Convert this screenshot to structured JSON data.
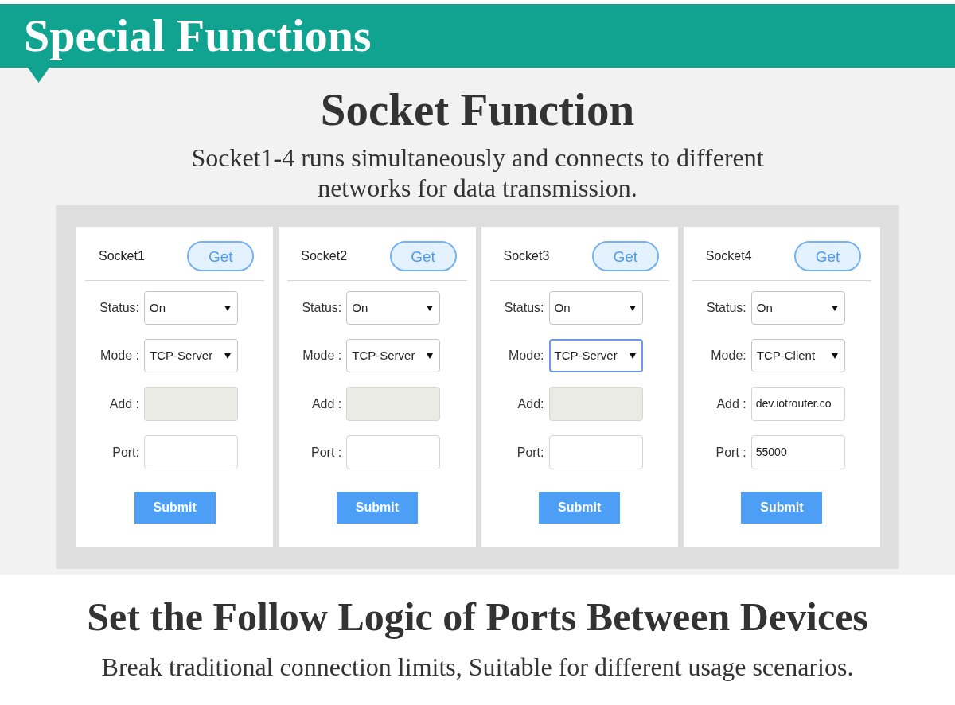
{
  "banner": {
    "title": "Special Functions"
  },
  "section": {
    "heading": "Socket Function",
    "description": "Socket1-4 runs simultaneously and connects to different networks for data transmission."
  },
  "sockets": [
    {
      "name": "Socket1",
      "get_button": "Get",
      "fields": [
        {
          "kind": "select",
          "label": "Status:",
          "value": "On",
          "focused": false
        },
        {
          "kind": "select",
          "label": "Mode :",
          "value": "TCP-Server",
          "focused": false
        },
        {
          "kind": "input",
          "label": "Add :",
          "disabled": true
        },
        {
          "kind": "input",
          "label": "Port:",
          "disabled": false
        }
      ],
      "submit_button": "Submit"
    },
    {
      "name": "Socket2",
      "get_button": "Get",
      "fields": [
        {
          "kind": "select",
          "label": "Status:",
          "value": "On",
          "focused": false
        },
        {
          "kind": "select",
          "label": "Mode :",
          "value": "TCP-Server",
          "focused": false
        },
        {
          "kind": "input",
          "label": "Add :",
          "disabled": true
        },
        {
          "kind": "input",
          "label": "Port :",
          "disabled": false
        }
      ],
      "submit_button": "Submit"
    },
    {
      "name": "Socket3",
      "get_button": "Get",
      "fields": [
        {
          "kind": "select",
          "label": "Status:",
          "value": "On",
          "focused": false
        },
        {
          "kind": "select",
          "label": "Mode:",
          "value": "TCP-Server",
          "focused": true
        },
        {
          "kind": "input",
          "label": "Add:",
          "disabled": true
        },
        {
          "kind": "input",
          "label": "Port:",
          "disabled": false
        }
      ],
      "submit_button": "Submit"
    },
    {
      "name": "Socket4",
      "get_button": "Get",
      "fields": [
        {
          "kind": "select",
          "label": "Status:",
          "value": "On",
          "focused": false
        },
        {
          "kind": "select",
          "label": "Mode:",
          "value": "TCP-Client",
          "focused": false
        },
        {
          "kind": "input",
          "label": "Add :",
          "value": "dev.iotrouter.co",
          "disabled": false
        },
        {
          "kind": "input",
          "label": "Port :",
          "value": "55000",
          "disabled": false
        }
      ],
      "submit_button": "Submit"
    }
  ],
  "footer": {
    "heading": "Set the Follow Logic of Ports Between Devices",
    "description": "Break traditional connection limits, Suitable for different usage scenarios."
  }
}
